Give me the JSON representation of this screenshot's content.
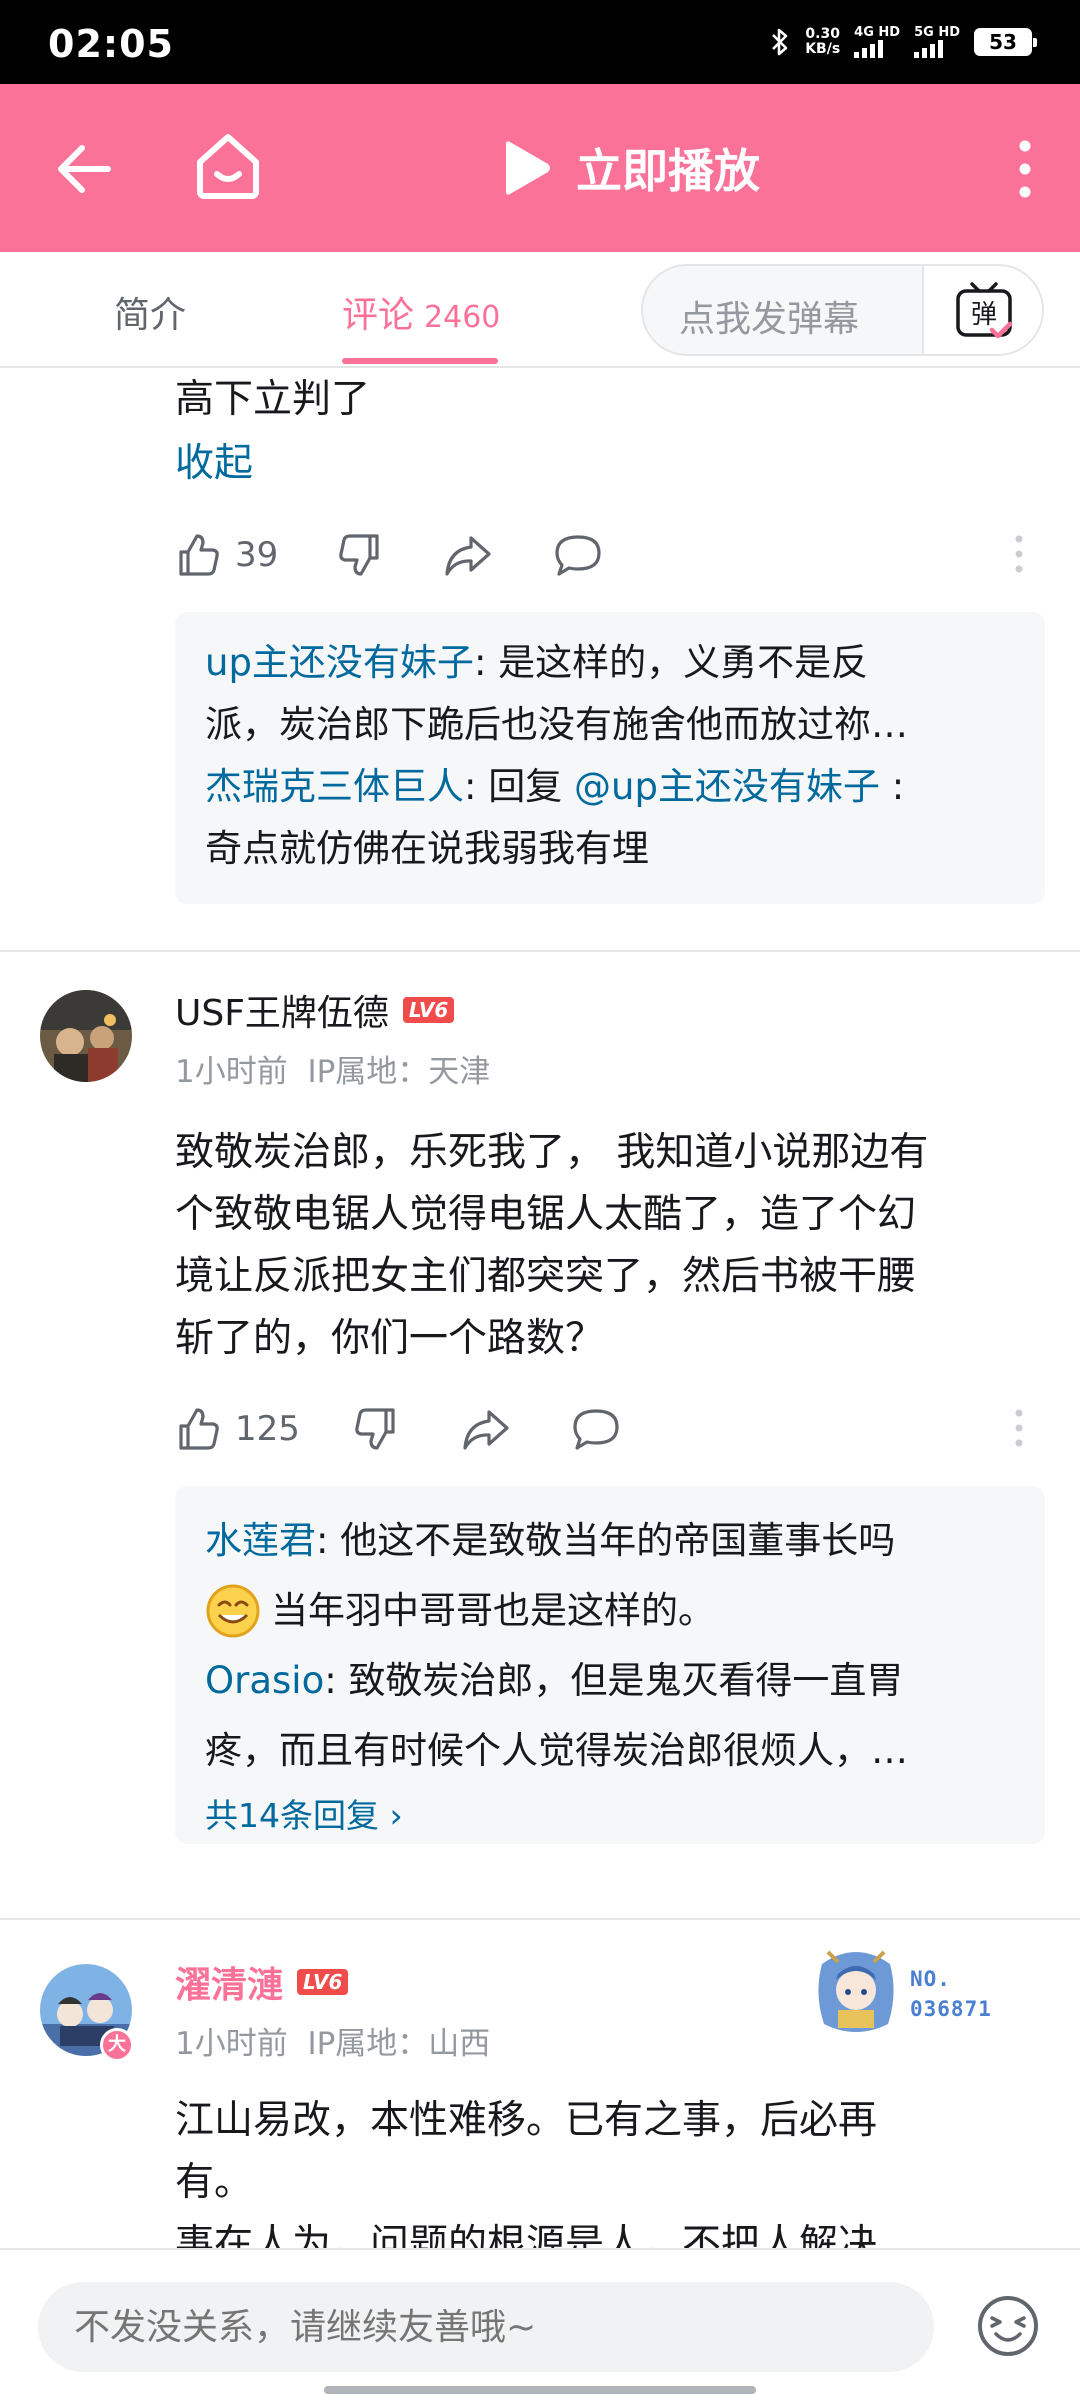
{
  "status_bar": {
    "time": "02:05",
    "net_speed_value": "0.30",
    "net_speed_unit": "KB/s",
    "signal1": "4G HD",
    "signal2": "5G HD",
    "battery": "53"
  },
  "topbar": {
    "play_label": "立即播放",
    "accent": "#fb7299"
  },
  "tabs": {
    "intro": "简介",
    "comments": "评论",
    "comments_count": "2460",
    "danmaku_placeholder": "点我发弹幕",
    "danmaku_btn": "弹"
  },
  "comment_partial": {
    "text_tail": "高下立判了",
    "collapse": "收起",
    "likes": "39",
    "replies": [
      {
        "user": "up主还没有妹子",
        "sep": ": ",
        "line1": "是这样的，义勇不是反",
        "line2": "派，炭治郎下跪后也没有施舍他而放过祢…"
      },
      {
        "user": "杰瑞克三体巨人",
        "sep": ": ",
        "reply_prefix": "回复 ",
        "mention": "@up主还没有妹子",
        "colon": " :",
        "line2": "奇点就仿佛在说我弱我有埋"
      }
    ]
  },
  "comment2": {
    "username": "USF王牌伍德",
    "level": "LV6",
    "time": "1小时前",
    "ip": "IP属地：天津",
    "lines": [
      "致敬炭治郎，乐死我了， 我知道小说那边有",
      "个致敬电锯人觉得电锯人太酷了，造了个幻",
      "境让反派把女主们都突突了，然后书被干腰",
      "斩了的，你们一个路数？"
    ],
    "likes": "125",
    "replies": [
      {
        "user": "水莲君",
        "sep": ": ",
        "line1": "他这不是致敬当年的帝国董事长吗",
        "line2": "当年羽中哥哥也是这样的。"
      },
      {
        "user": "Orasio",
        "sep": ": ",
        "line1": "致敬炭治郎，但是鬼灭看得一直胃",
        "line2": "疼，而且有时候个人觉得炭治郎很烦人，…"
      }
    ],
    "more_replies": "共14条回复 ›"
  },
  "comment3": {
    "username": "濯清漣",
    "level": "LV6",
    "time": "1小时前",
    "ip": "IP属地：山西",
    "avatar_badge": "大",
    "badge_no_label": "NO.",
    "badge_no_value": "036871",
    "lines": [
      "江山易改，本性难移。已有之事，后必再",
      "有。",
      "事在人为，问题的根源是人，不把人解决"
    ]
  },
  "bottom_bar": {
    "input_placeholder": "不发没关系，请继续友善哦~"
  }
}
